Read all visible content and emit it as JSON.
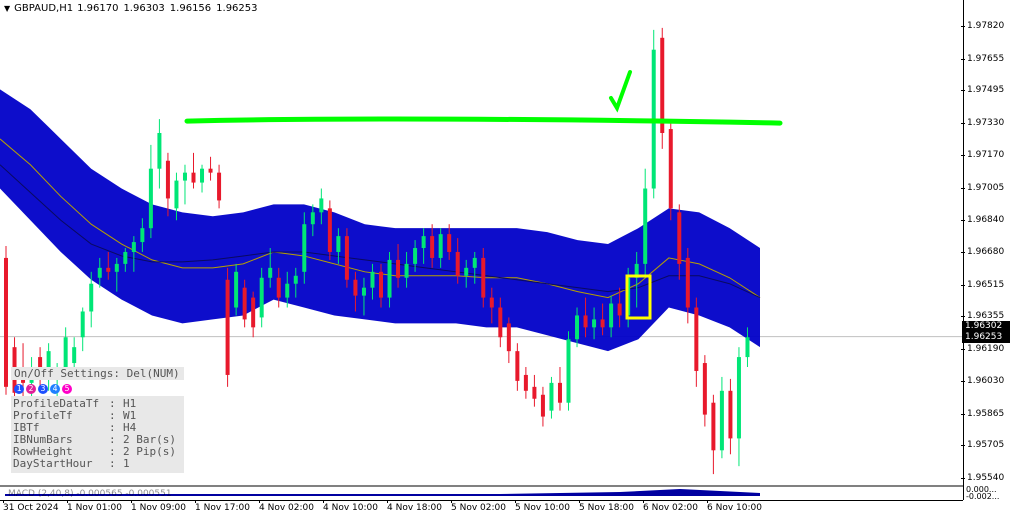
{
  "header": {
    "symbol": "GBPAUD,H1",
    "open": "1.96170",
    "high": "1.96303",
    "low": "1.96156",
    "close": "1.96253"
  },
  "price_scale": [
    "1.97820",
    "1.97655",
    "1.97495",
    "1.97330",
    "1.97170",
    "1.97005",
    "1.96840",
    "1.96680",
    "1.96515",
    "1.96355",
    "1.96190",
    "1.96030",
    "1.95865",
    "1.95705",
    "1.95540"
  ],
  "price_labels": {
    "high_marker": "1.96302",
    "current": "1.96253"
  },
  "time_scale": [
    "31 Oct 2024",
    "1 Nov 01:00",
    "1 Nov 09:00",
    "1 Nov 17:00",
    "4 Nov 02:00",
    "4 Nov 10:00",
    "4 Nov 18:00",
    "5 Nov 02:00",
    "5 Nov 10:00",
    "5 Nov 18:00",
    "6 Nov 02:00",
    "6 Nov 10:00"
  ],
  "panel": {
    "toggle_text": "On/Off Settings: Del(NUM)",
    "circle_labels": [
      "1",
      "2",
      "3",
      "4",
      "5"
    ],
    "circle_colors": [
      "#1e50ff",
      "#e0209a",
      "#1e50ff",
      "#2080ff",
      "#ff00c8"
    ],
    "settings": [
      {
        "key": "ProfileDataTf",
        "value": "H1"
      },
      {
        "key": "ProfileTf",
        "value": "W1"
      },
      {
        "key": "IBTf",
        "value": "H4"
      },
      {
        "key": "IBNumBars",
        "value": "2 Bar(s)"
      },
      {
        "key": "RowHeight",
        "value": "2 Pip(s)"
      },
      {
        "key": "DayStartHour",
        "value": "1"
      }
    ]
  },
  "subwindow": {
    "label": "MACD (2,40,8) -0.000565 -0.000551",
    "scale_top": "0.000...",
    "scale_bottom": "-0.002..."
  },
  "colors": {
    "bull": "#00e676",
    "bear": "#e8192c",
    "band": "#0000c8",
    "trendline": "#00ff00",
    "annotation_box": "#ffff00",
    "checkmark": "#00ff00"
  },
  "chart_data": {
    "type": "candlestick",
    "title": "",
    "ylim": [
      1.955,
      1.9788
    ],
    "candles": [
      {
        "o": 1.9665,
        "h": 1.9671,
        "l": 1.9596,
        "c": 1.96
      },
      {
        "o": 1.962,
        "h": 1.9625,
        "l": 1.959,
        "c": 1.9597
      },
      {
        "o": 1.961,
        "h": 1.9622,
        "l": 1.9595,
        "c": 1.9602
      },
      {
        "o": 1.9602,
        "h": 1.9615,
        "l": 1.9594,
        "c": 1.961
      },
      {
        "o": 1.9615,
        "h": 1.962,
        "l": 1.96,
        "c": 1.9608
      },
      {
        "o": 1.9608,
        "h": 1.9622,
        "l": 1.9598,
        "c": 1.9618
      },
      {
        "o": 1.9604,
        "h": 1.9612,
        "l": 1.9594,
        "c": 1.9608
      },
      {
        "o": 1.9608,
        "h": 1.963,
        "l": 1.9604,
        "c": 1.9625
      },
      {
        "o": 1.9612,
        "h": 1.9625,
        "l": 1.9608,
        "c": 1.962
      },
      {
        "o": 1.9625,
        "h": 1.964,
        "l": 1.9618,
        "c": 1.9638
      },
      {
        "o": 1.9638,
        "h": 1.9658,
        "l": 1.963,
        "c": 1.9652
      },
      {
        "o": 1.9655,
        "h": 1.9665,
        "l": 1.965,
        "c": 1.966
      },
      {
        "o": 1.966,
        "h": 1.9668,
        "l": 1.9654,
        "c": 1.9658
      },
      {
        "o": 1.9658,
        "h": 1.9665,
        "l": 1.9648,
        "c": 1.9662
      },
      {
        "o": 1.9662,
        "h": 1.967,
        "l": 1.9658,
        "c": 1.9668
      },
      {
        "o": 1.9668,
        "h": 1.9676,
        "l": 1.9658,
        "c": 1.9673
      },
      {
        "o": 1.9673,
        "h": 1.9685,
        "l": 1.9668,
        "c": 1.968
      },
      {
        "o": 1.968,
        "h": 1.9722,
        "l": 1.9675,
        "c": 1.971
      },
      {
        "o": 1.971,
        "h": 1.9735,
        "l": 1.97,
        "c": 1.9728
      },
      {
        "o": 1.9714,
        "h": 1.9718,
        "l": 1.9686,
        "c": 1.9695
      },
      {
        "o": 1.969,
        "h": 1.9708,
        "l": 1.9684,
        "c": 1.9704
      },
      {
        "o": 1.9704,
        "h": 1.9712,
        "l": 1.9692,
        "c": 1.9708
      },
      {
        "o": 1.9708,
        "h": 1.9718,
        "l": 1.97,
        "c": 1.9703
      },
      {
        "o": 1.9703,
        "h": 1.9712,
        "l": 1.9698,
        "c": 1.971
      },
      {
        "o": 1.971,
        "h": 1.9716,
        "l": 1.9704,
        "c": 1.9708
      },
      {
        "o": 1.9708,
        "h": 1.9712,
        "l": 1.969,
        "c": 1.9694
      },
      {
        "o": 1.9654,
        "h": 1.966,
        "l": 1.96,
        "c": 1.9606
      },
      {
        "o": 1.964,
        "h": 1.9662,
        "l": 1.9636,
        "c": 1.9658
      },
      {
        "o": 1.965,
        "h": 1.9654,
        "l": 1.963,
        "c": 1.9634
      },
      {
        "o": 1.9645,
        "h": 1.9648,
        "l": 1.9625,
        "c": 1.963
      },
      {
        "o": 1.9635,
        "h": 1.966,
        "l": 1.963,
        "c": 1.9655
      },
      {
        "o": 1.9655,
        "h": 1.967,
        "l": 1.965,
        "c": 1.966
      },
      {
        "o": 1.9655,
        "h": 1.966,
        "l": 1.964,
        "c": 1.9645
      },
      {
        "o": 1.9645,
        "h": 1.9658,
        "l": 1.964,
        "c": 1.9652
      },
      {
        "o": 1.9652,
        "h": 1.966,
        "l": 1.9645,
        "c": 1.9656
      },
      {
        "o": 1.9658,
        "h": 1.9688,
        "l": 1.9652,
        "c": 1.9682
      },
      {
        "o": 1.9682,
        "h": 1.9692,
        "l": 1.9676,
        "c": 1.9688
      },
      {
        "o": 1.9688,
        "h": 1.97,
        "l": 1.9682,
        "c": 1.9695
      },
      {
        "o": 1.969,
        "h": 1.9694,
        "l": 1.9664,
        "c": 1.9668
      },
      {
        "o": 1.9668,
        "h": 1.968,
        "l": 1.9662,
        "c": 1.9676
      },
      {
        "o": 1.9676,
        "h": 1.968,
        "l": 1.965,
        "c": 1.9654
      },
      {
        "o": 1.9654,
        "h": 1.9658,
        "l": 1.9638,
        "c": 1.9646
      },
      {
        "o": 1.9646,
        "h": 1.9655,
        "l": 1.9636,
        "c": 1.965
      },
      {
        "o": 1.965,
        "h": 1.9662,
        "l": 1.9644,
        "c": 1.9658
      },
      {
        "o": 1.9658,
        "h": 1.9662,
        "l": 1.964,
        "c": 1.9645
      },
      {
        "o": 1.9645,
        "h": 1.9668,
        "l": 1.964,
        "c": 1.9664
      },
      {
        "o": 1.9664,
        "h": 1.9672,
        "l": 1.965,
        "c": 1.9655
      },
      {
        "o": 1.9655,
        "h": 1.9668,
        "l": 1.965,
        "c": 1.9662
      },
      {
        "o": 1.9662,
        "h": 1.9674,
        "l": 1.9658,
        "c": 1.967
      },
      {
        "o": 1.967,
        "h": 1.968,
        "l": 1.9662,
        "c": 1.9676
      },
      {
        "o": 1.9676,
        "h": 1.9682,
        "l": 1.966,
        "c": 1.9665
      },
      {
        "o": 1.9665,
        "h": 1.968,
        "l": 1.966,
        "c": 1.9677
      },
      {
        "o": 1.9677,
        "h": 1.9682,
        "l": 1.9664,
        "c": 1.9668
      },
      {
        "o": 1.9668,
        "h": 1.9675,
        "l": 1.9652,
        "c": 1.9656
      },
      {
        "o": 1.9656,
        "h": 1.9664,
        "l": 1.965,
        "c": 1.966
      },
      {
        "o": 1.966,
        "h": 1.9668,
        "l": 1.9652,
        "c": 1.9665
      },
      {
        "o": 1.9665,
        "h": 1.967,
        "l": 1.964,
        "c": 1.9645
      },
      {
        "o": 1.9645,
        "h": 1.965,
        "l": 1.9632,
        "c": 1.964
      },
      {
        "o": 1.964,
        "h": 1.9645,
        "l": 1.962,
        "c": 1.9625
      },
      {
        "o": 1.9632,
        "h": 1.9635,
        "l": 1.9612,
        "c": 1.9618
      },
      {
        "o": 1.9618,
        "h": 1.9622,
        "l": 1.9598,
        "c": 1.9603
      },
      {
        "o": 1.9606,
        "h": 1.961,
        "l": 1.9594,
        "c": 1.9598
      },
      {
        "o": 1.96,
        "h": 1.9606,
        "l": 1.959,
        "c": 1.9594
      },
      {
        "o": 1.9596,
        "h": 1.96,
        "l": 1.958,
        "c": 1.9585
      },
      {
        "o": 1.9588,
        "h": 1.9605,
        "l": 1.9584,
        "c": 1.9602
      },
      {
        "o": 1.9602,
        "h": 1.961,
        "l": 1.9588,
        "c": 1.9592
      },
      {
        "o": 1.9592,
        "h": 1.9628,
        "l": 1.9588,
        "c": 1.9624
      },
      {
        "o": 1.9624,
        "h": 1.964,
        "l": 1.962,
        "c": 1.9636
      },
      {
        "o": 1.9636,
        "h": 1.9645,
        "l": 1.9625,
        "c": 1.963
      },
      {
        "o": 1.963,
        "h": 1.964,
        "l": 1.9624,
        "c": 1.9634
      },
      {
        "o": 1.9634,
        "h": 1.9642,
        "l": 1.9626,
        "c": 1.963
      },
      {
        "o": 1.963,
        "h": 1.9646,
        "l": 1.9625,
        "c": 1.9642
      },
      {
        "o": 1.9642,
        "h": 1.965,
        "l": 1.963,
        "c": 1.9636
      },
      {
        "o": 1.9636,
        "h": 1.966,
        "l": 1.963,
        "c": 1.9655
      },
      {
        "o": 1.9655,
        "h": 1.9668,
        "l": 1.964,
        "c": 1.9662
      },
      {
        "o": 1.9662,
        "h": 1.971,
        "l": 1.9655,
        "c": 1.97
      },
      {
        "o": 1.97,
        "h": 1.978,
        "l": 1.9695,
        "c": 1.977
      },
      {
        "o": 1.9776,
        "h": 1.9781,
        "l": 1.972,
        "c": 1.9728
      },
      {
        "o": 1.973,
        "h": 1.9735,
        "l": 1.9684,
        "c": 1.969
      },
      {
        "o": 1.9688,
        "h": 1.9692,
        "l": 1.9654,
        "c": 1.9662
      },
      {
        "o": 1.9665,
        "h": 1.967,
        "l": 1.9632,
        "c": 1.964
      },
      {
        "o": 1.964,
        "h": 1.9645,
        "l": 1.96,
        "c": 1.9608
      },
      {
        "o": 1.9612,
        "h": 1.9616,
        "l": 1.958,
        "c": 1.9586
      },
      {
        "o": 1.9592,
        "h": 1.9596,
        "l": 1.9556,
        "c": 1.9568
      },
      {
        "o": 1.9568,
        "h": 1.9605,
        "l": 1.9564,
        "c": 1.9598
      },
      {
        "o": 1.9598,
        "h": 1.9604,
        "l": 1.9566,
        "c": 1.9574
      },
      {
        "o": 1.9574,
        "h": 1.962,
        "l": 1.956,
        "c": 1.9615
      },
      {
        "o": 1.9615,
        "h": 1.963,
        "l": 1.961,
        "c": 1.9625
      }
    ],
    "bands": {
      "upper": [
        1.975,
        1.974,
        1.9725,
        1.971,
        1.97,
        1.9692,
        1.9688,
        1.9686,
        1.9688,
        1.9692,
        1.9692,
        1.9688,
        1.9682,
        1.968,
        1.968,
        1.968,
        1.968,
        1.968,
        1.9678,
        1.9674,
        1.9672,
        1.968,
        1.969,
        1.9688,
        1.968,
        1.967
      ],
      "mid": [
        1.9725,
        1.9712,
        1.9696,
        1.9682,
        1.9672,
        1.9664,
        1.966,
        1.966,
        1.9662,
        1.9668,
        1.9666,
        1.9662,
        1.9658,
        1.9656,
        1.9656,
        1.9656,
        1.9655,
        1.9655,
        1.9652,
        1.9648,
        1.9645,
        1.9652,
        1.9665,
        1.9662,
        1.9655,
        1.9645
      ],
      "lower": [
        1.97,
        1.9684,
        1.9668,
        1.9654,
        1.9644,
        1.9636,
        1.9632,
        1.9634,
        1.9636,
        1.9644,
        1.964,
        1.9636,
        1.9634,
        1.9632,
        1.9632,
        1.9632,
        1.963,
        1.963,
        1.9626,
        1.9622,
        1.9618,
        1.9624,
        1.964,
        1.9636,
        1.963,
        1.962
      ],
      "ma_line": [
        1.9712,
        1.9698,
        1.9684,
        1.9672,
        1.9666,
        1.9663,
        1.9663,
        1.9664,
        1.9666,
        1.9668,
        1.9668,
        1.9666,
        1.9664,
        1.9662,
        1.966,
        1.9658,
        1.9656,
        1.9654,
        1.9652,
        1.965,
        1.9648,
        1.965,
        1.9656,
        1.9656,
        1.9652,
        1.9645
      ]
    },
    "trendline": {
      "from": 1.9733,
      "to": 1.9733
    }
  }
}
